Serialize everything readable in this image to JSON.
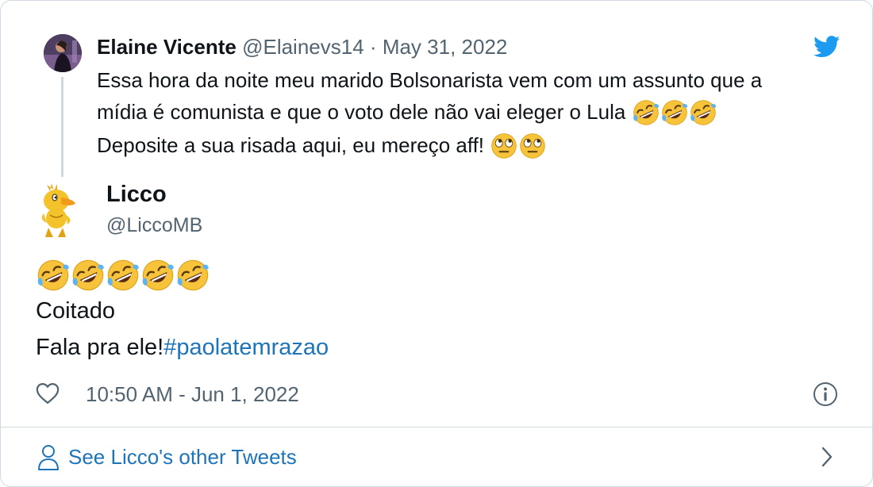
{
  "quoted_tweet": {
    "author_name": "Elaine Vicente",
    "author_handle": "@Elainevs14",
    "separator": "·",
    "date": "May 31, 2022",
    "text_lines": [
      "Essa hora da noite meu marido Bolsonarista vem com um assunto que a",
      "mídia é comunista e que o voto dele não vai eleger o Lula",
      "Deposite a sua risada aqui, eu mereço aff!"
    ],
    "line2_emojis": [
      "rolling-on-floor-laughing",
      "rolling-on-floor-laughing",
      "rolling-on-floor-laughing"
    ],
    "line3_emojis": [
      "face-with-rolling-eyes",
      "face-with-rolling-eyes"
    ]
  },
  "tweet": {
    "author_name": "Licco",
    "author_handle": "@LiccoMB",
    "emojis": [
      "rolling-on-floor-laughing",
      "rolling-on-floor-laughing",
      "rolling-on-floor-laughing",
      "rolling-on-floor-laughing",
      "rolling-on-floor-laughing"
    ],
    "line1": "Coitado",
    "line2_text": "Fala pra ele!",
    "hashtag": "#paolatemrazao",
    "timestamp": "10:50 AM - Jun 1, 2022"
  },
  "footer": {
    "label": "See Licco's other Tweets"
  },
  "icons": {
    "brand": "twitter-bird-icon",
    "like": "heart-icon",
    "info": "info-icon",
    "profile": "person-icon",
    "next": "chevron-right-icon"
  },
  "colors": {
    "brand_blue": "#1d9bf0",
    "link_blue": "#1d74b8",
    "text": "#0f1419",
    "secondary_text": "#536471",
    "border": "#cfd9de",
    "emoji_yellow": "#f7c33b"
  }
}
